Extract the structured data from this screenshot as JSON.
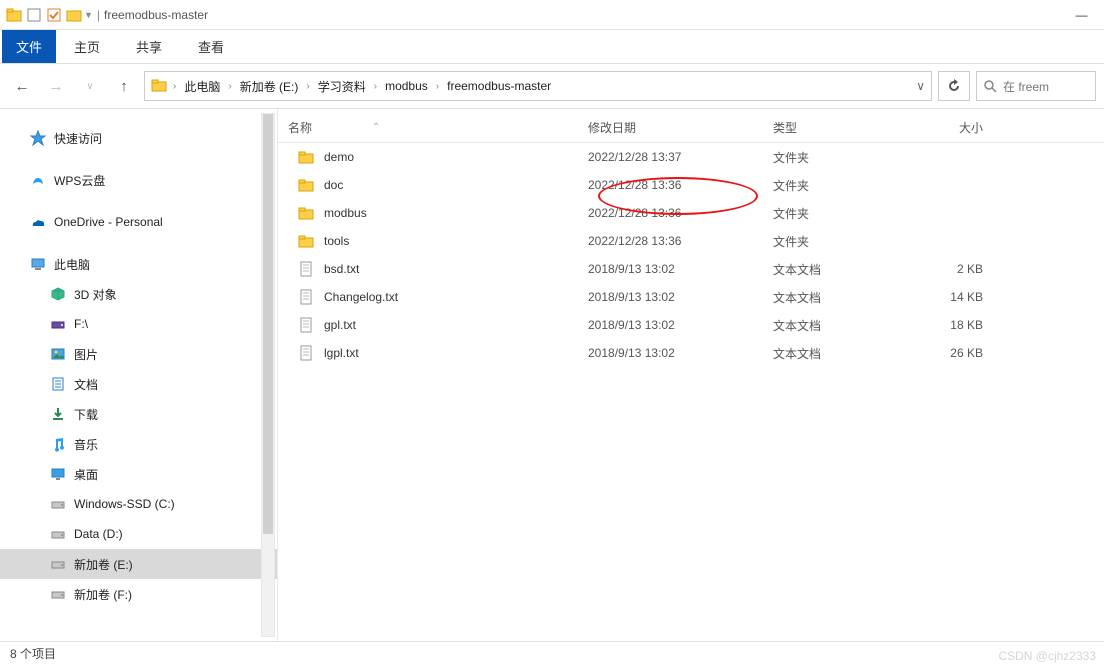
{
  "window": {
    "title": "freemodbus-master"
  },
  "ribbon": {
    "file": "文件",
    "tabs": [
      "主页",
      "共享",
      "查看"
    ]
  },
  "breadcrumb": {
    "items": [
      "此电脑",
      "新加卷 (E:)",
      "学习资料",
      "modbus",
      "freemodbus-master"
    ]
  },
  "search": {
    "placeholder": "在 freem"
  },
  "sidebar": {
    "items": [
      {
        "icon": "star",
        "label": "快速访问"
      },
      {
        "icon": "wps",
        "label": "WPS云盘"
      },
      {
        "icon": "onedrive",
        "label": "OneDrive - Personal"
      },
      {
        "icon": "pc",
        "label": "此电脑"
      },
      {
        "icon": "3d",
        "label": "3D 对象",
        "level": 2
      },
      {
        "icon": "drive-f",
        "label": "F:\\",
        "level": 2
      },
      {
        "icon": "pictures",
        "label": "图片",
        "level": 2
      },
      {
        "icon": "docs",
        "label": "文档",
        "level": 2
      },
      {
        "icon": "downloads",
        "label": "下载",
        "level": 2
      },
      {
        "icon": "music",
        "label": "音乐",
        "level": 2
      },
      {
        "icon": "desktop",
        "label": "桌面",
        "level": 2
      },
      {
        "icon": "disk",
        "label": "Windows-SSD (C:)",
        "level": 2
      },
      {
        "icon": "disk",
        "label": "Data (D:)",
        "level": 2
      },
      {
        "icon": "disk",
        "label": "新加卷 (E:)",
        "level": 2,
        "selected": true
      },
      {
        "icon": "disk",
        "label": "新加卷 (F:)",
        "level": 2
      }
    ]
  },
  "columns": {
    "name": "名称",
    "date": "修改日期",
    "type": "类型",
    "size": "大小"
  },
  "files": [
    {
      "icon": "folder",
      "name": "demo",
      "date": "2022/12/28 13:37",
      "type": "文件夹",
      "size": ""
    },
    {
      "icon": "folder",
      "name": "doc",
      "date": "2022/12/28 13:36",
      "type": "文件夹",
      "size": ""
    },
    {
      "icon": "folder",
      "name": "modbus",
      "date": "2022/12/28 13:36",
      "type": "文件夹",
      "size": ""
    },
    {
      "icon": "folder",
      "name": "tools",
      "date": "2022/12/28 13:36",
      "type": "文件夹",
      "size": ""
    },
    {
      "icon": "file",
      "name": "bsd.txt",
      "date": "2018/9/13 13:02",
      "type": "文本文档",
      "size": "2 KB"
    },
    {
      "icon": "file",
      "name": "Changelog.txt",
      "date": "2018/9/13 13:02",
      "type": "文本文档",
      "size": "14 KB"
    },
    {
      "icon": "file",
      "name": "gpl.txt",
      "date": "2018/9/13 13:02",
      "type": "文本文档",
      "size": "18 KB"
    },
    {
      "icon": "file",
      "name": "lgpl.txt",
      "date": "2018/9/13 13:02",
      "type": "文本文档",
      "size": "26 KB"
    }
  ],
  "status": {
    "text": "8 个项目"
  },
  "watermark": "CSDN @cjhz2333"
}
